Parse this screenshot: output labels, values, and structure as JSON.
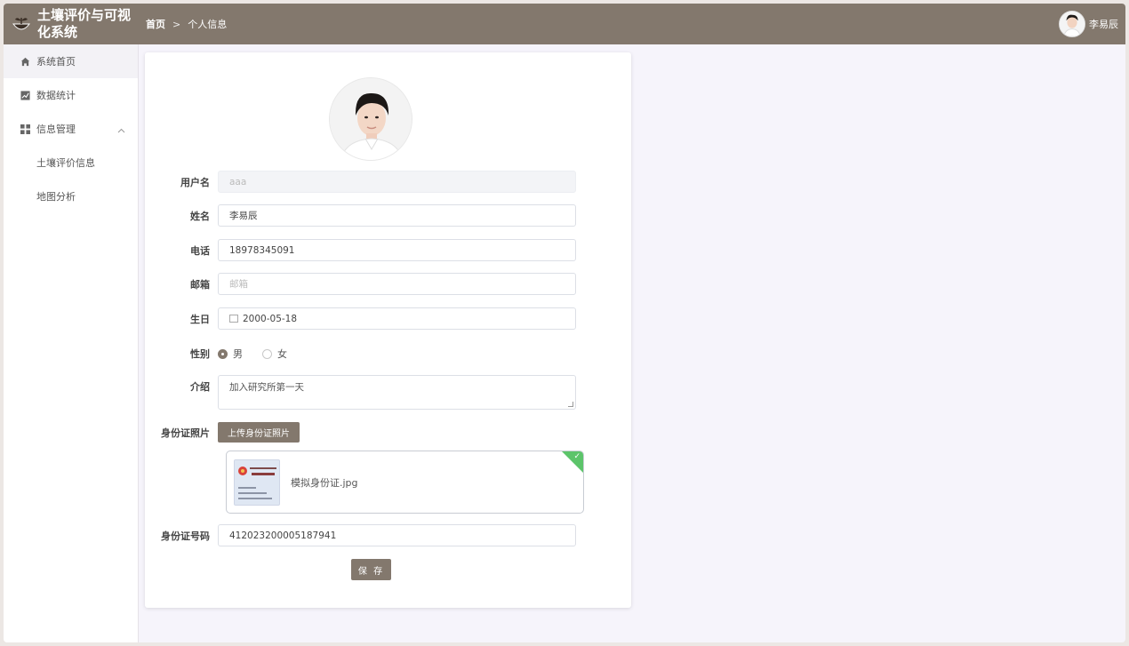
{
  "header": {
    "app_title": "土壤评价与可视化系统",
    "breadcrumb": {
      "home": "首页",
      "separator": ">",
      "current": "个人信息"
    },
    "user_name": "李易辰",
    "bg_color": "#83786d"
  },
  "sidebar": {
    "items": [
      {
        "label": "系统首页",
        "icon": "home-icon",
        "active": true
      },
      {
        "label": "数据统计",
        "icon": "chart-icon"
      },
      {
        "label": "信息管理",
        "icon": "grid-icon",
        "expanded": true,
        "children": [
          {
            "label": "土壤评价信息"
          },
          {
            "label": "地图分析"
          }
        ]
      }
    ]
  },
  "form": {
    "username": {
      "label": "用户名",
      "value": "aaa"
    },
    "name": {
      "label": "姓名",
      "value": "李易辰"
    },
    "phone": {
      "label": "电话",
      "value": "18978345091"
    },
    "email": {
      "label": "邮箱",
      "placeholder": "邮箱"
    },
    "birthday": {
      "label": "生日",
      "value": "2000-05-18"
    },
    "gender": {
      "label": "性别",
      "options": [
        "男",
        "女"
      ],
      "selected": "男"
    },
    "intro": {
      "label": "介绍",
      "value": "加入研究所第一天"
    },
    "id_photo": {
      "label": "身份证照片",
      "button": "上传身份证照片",
      "file_name": "模拟身份证.jpg"
    },
    "id_number": {
      "label": "身份证号码",
      "value": "412023200005187941"
    },
    "save_label": "保 存"
  }
}
